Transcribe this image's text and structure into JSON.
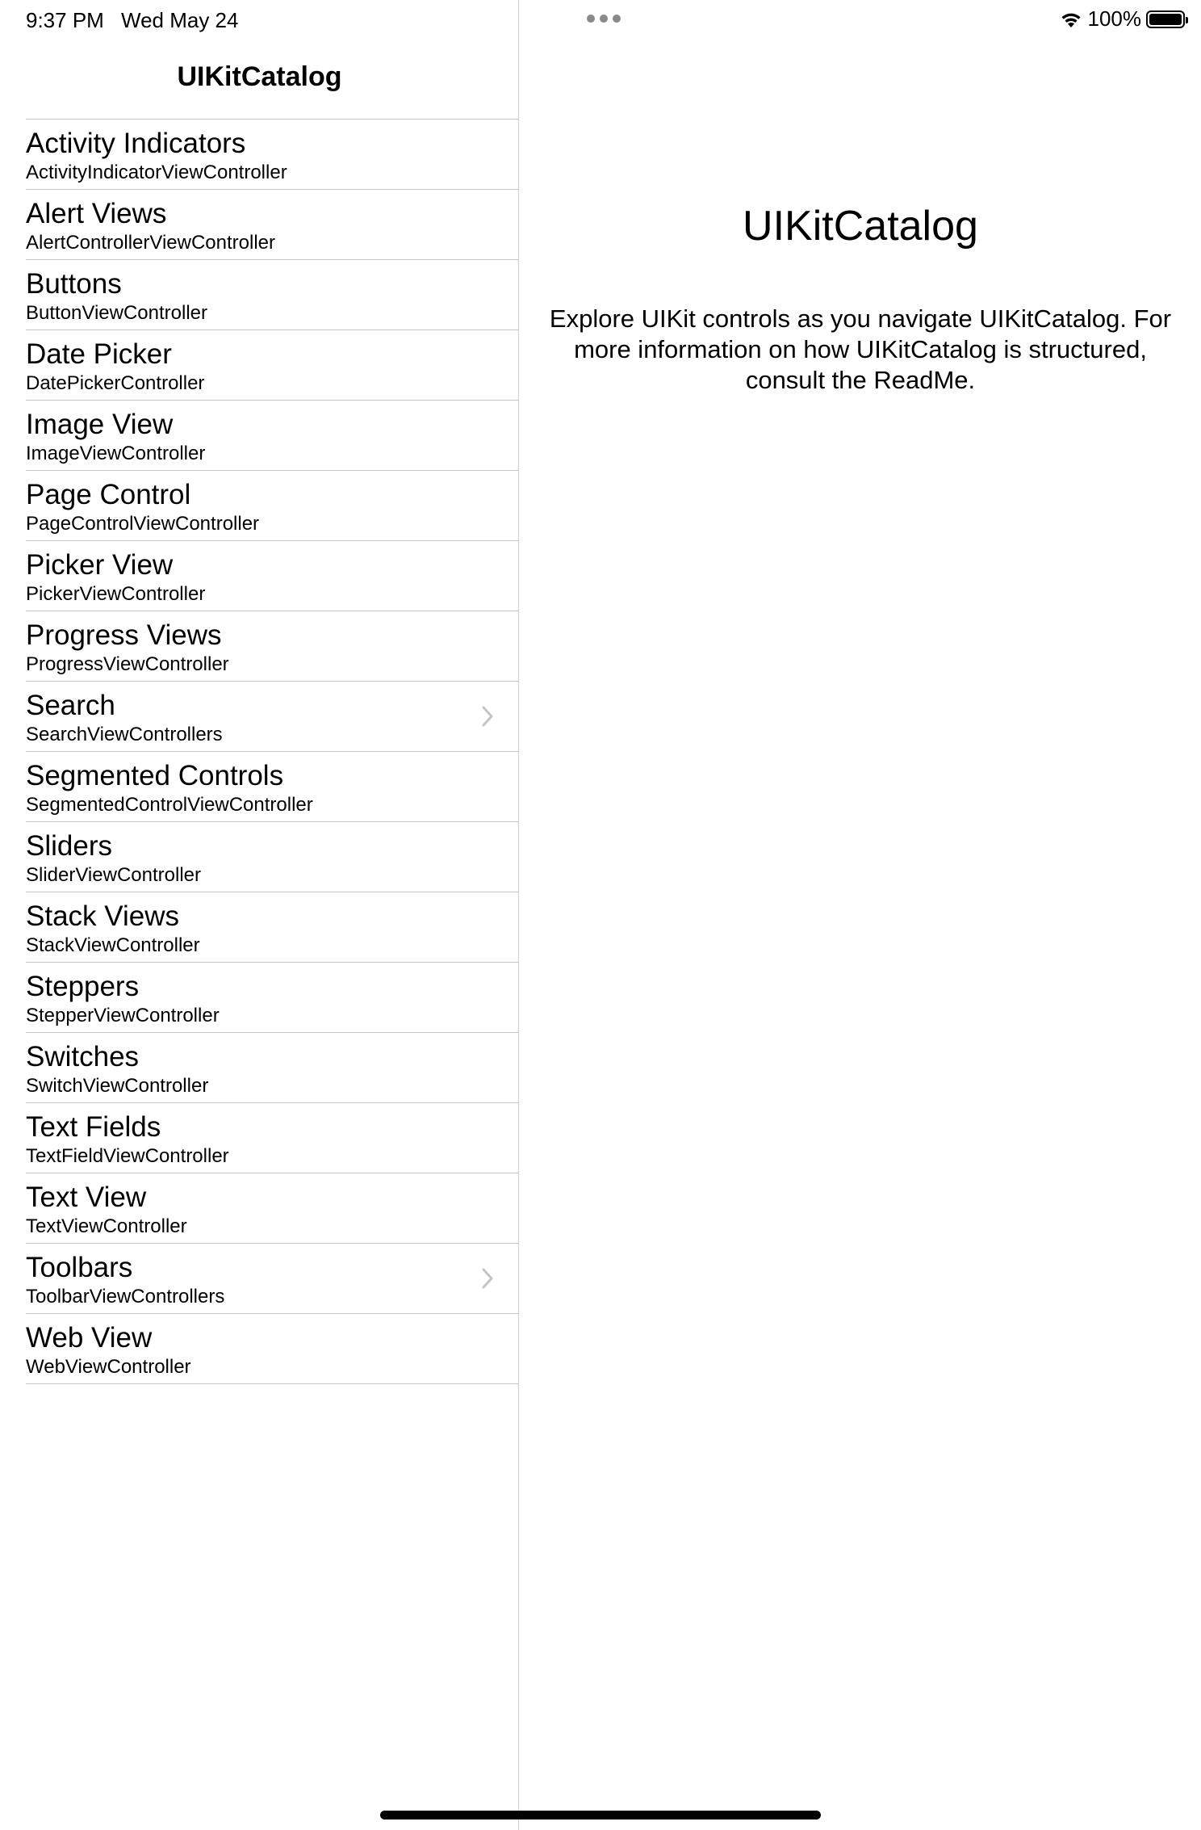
{
  "status_bar": {
    "time": "9:37 PM",
    "date": "Wed May 24",
    "battery": "100%",
    "icons": [
      "multitasking-dots-icon",
      "wifi-icon",
      "battery-icon"
    ]
  },
  "master": {
    "title": "UIKitCatalog",
    "rows": [
      {
        "title": "Activity Indicators",
        "subtitle": "ActivityIndicatorViewController",
        "chevron": false
      },
      {
        "title": "Alert Views",
        "subtitle": "AlertControllerViewController",
        "chevron": false
      },
      {
        "title": "Buttons",
        "subtitle": "ButtonViewController",
        "chevron": false
      },
      {
        "title": "Date Picker",
        "subtitle": "DatePickerController",
        "chevron": false
      },
      {
        "title": "Image View",
        "subtitle": "ImageViewController",
        "chevron": false
      },
      {
        "title": "Page Control",
        "subtitle": "PageControlViewController",
        "chevron": false
      },
      {
        "title": "Picker View",
        "subtitle": "PickerViewController",
        "chevron": false
      },
      {
        "title": "Progress Views",
        "subtitle": "ProgressViewController",
        "chevron": false
      },
      {
        "title": "Search",
        "subtitle": "SearchViewControllers",
        "chevron": true
      },
      {
        "title": "Segmented Controls",
        "subtitle": "SegmentedControlViewController",
        "chevron": false
      },
      {
        "title": "Sliders",
        "subtitle": "SliderViewController",
        "chevron": false
      },
      {
        "title": "Stack Views",
        "subtitle": "StackViewController",
        "chevron": false
      },
      {
        "title": "Steppers",
        "subtitle": "StepperViewController",
        "chevron": false
      },
      {
        "title": "Switches",
        "subtitle": "SwitchViewController",
        "chevron": false
      },
      {
        "title": "Text Fields",
        "subtitle": "TextFieldViewController",
        "chevron": false
      },
      {
        "title": "Text View",
        "subtitle": "TextViewController",
        "chevron": false
      },
      {
        "title": "Toolbars",
        "subtitle": "ToolbarViewControllers",
        "chevron": true
      },
      {
        "title": "Web View",
        "subtitle": "WebViewController",
        "chevron": false
      }
    ]
  },
  "detail": {
    "title": "UIKitCatalog",
    "body": "Explore UIKit controls as you navigate UIKitCatalog. For more information on how UIKitCatalog is structured, consult the ReadMe."
  },
  "colors": {
    "separator": "#c6c6c8",
    "chevron": "#c4c4c7",
    "text": "#000000",
    "background": "#ffffff"
  }
}
